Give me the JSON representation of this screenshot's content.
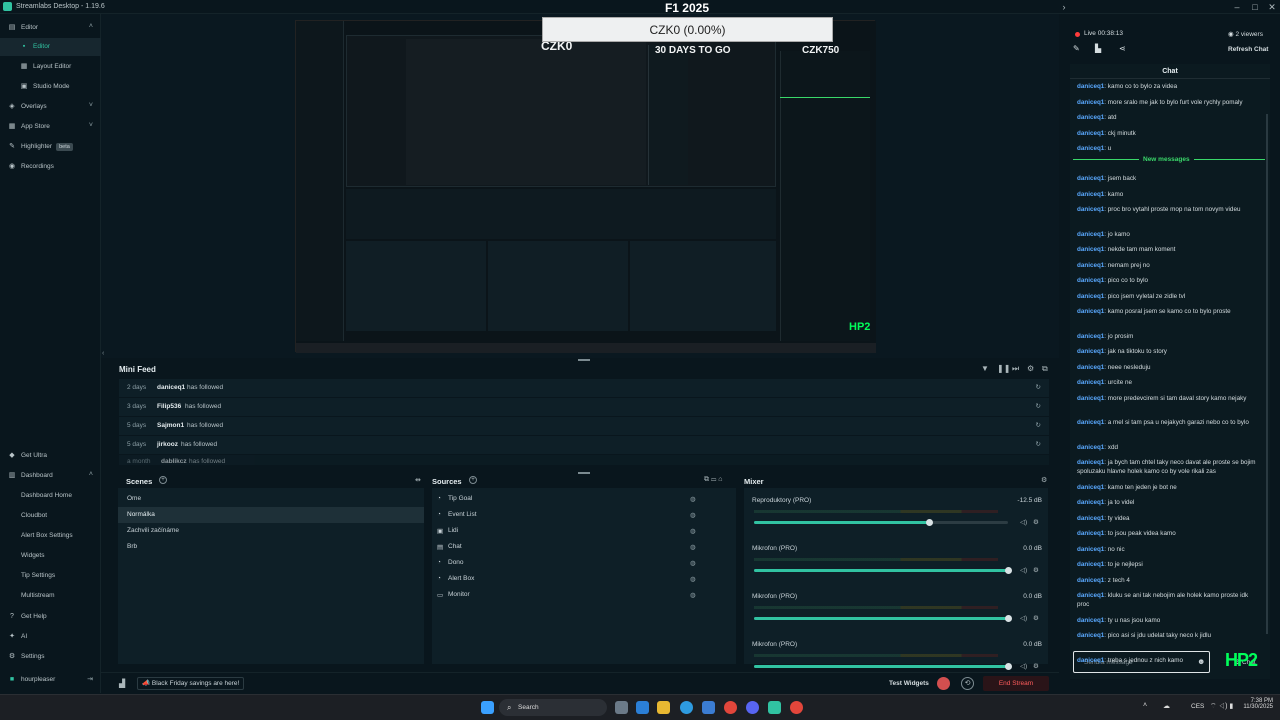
{
  "app": {
    "title": "Streamlabs Desktop - 1.19.6"
  },
  "sidebar": {
    "editor": "Editor",
    "editor_sub": [
      "Editor",
      "Layout Editor",
      "Studio Mode"
    ],
    "overlays": "Overlays",
    "app_store": "App Store",
    "highlighter": "Highlighter",
    "highlighter_badge": "beta",
    "recordings": "Recordings",
    "get_ultra": "Get Ultra",
    "dashboard": "Dashboard",
    "dashboard_sub": [
      "Dashboard Home",
      "Cloudbot",
      "Alert Box Settings",
      "Widgets",
      "Tip Settings",
      "Multistream"
    ],
    "get_help": "Get Help",
    "ai": "AI",
    "settings": "Settings",
    "user": "hourpleaser"
  },
  "preview": {
    "overlay_title": "F1 2025",
    "goal": "CZK0 (0.00%)",
    "goal_current": "CZK0",
    "days_to_go": "30 DAYS TO GO",
    "goal_target": "CZK750"
  },
  "minifeed": {
    "title": "Mini Feed",
    "rows": [
      {
        "time": "2 days",
        "name": "daniceq1",
        "action": "has followed"
      },
      {
        "time": "3 days",
        "name": "Filip536",
        "action": "has followed"
      },
      {
        "time": "5 days",
        "name": "Sajmon1",
        "action": "has followed"
      },
      {
        "time": "5 days",
        "name": "jirkooz",
        "action": "has followed"
      },
      {
        "time": "a month",
        "name": "dablikcz",
        "action": "has followed"
      }
    ]
  },
  "scenes": {
    "title": "Scenes",
    "items": [
      "Ome",
      "Normálka",
      "Zachvili začínáme",
      "Brb"
    ],
    "selected": 1
  },
  "sources": {
    "title": "Sources",
    "items": [
      {
        "label": "Tip Goal",
        "icon": "widget-icon"
      },
      {
        "label": "Event List",
        "icon": "widget-icon"
      },
      {
        "label": "Lidi",
        "icon": "image-icon"
      },
      {
        "label": "Chat",
        "icon": "chat-icon"
      },
      {
        "label": "Dono",
        "icon": "widget-icon"
      },
      {
        "label": "Alert Box",
        "icon": "widget-icon"
      },
      {
        "label": "Monitor",
        "icon": "monitor-icon"
      }
    ]
  },
  "mixer": {
    "title": "Mixer",
    "channels": [
      {
        "name": "Reproduktory (PRO)",
        "db": "-12.5 dB",
        "level": 0.69
      },
      {
        "name": "Mikrofon (PRO)",
        "db": "0.0 dB",
        "level": 1.0
      },
      {
        "name": "Mikrofon (PRO)",
        "db": "0.0 dB",
        "level": 1.0
      },
      {
        "name": "Mikrofon (PRO)",
        "db": "0.0 dB",
        "level": 1.0
      }
    ]
  },
  "footer": {
    "promo": "Black Friday savings are here!",
    "test_widgets": "Test Widgets",
    "end_stream": "End Stream"
  },
  "chat": {
    "live": "Live 00:38:13",
    "viewers": "2 viewers",
    "refresh": "Refresh Chat",
    "title": "Chat",
    "new_messages": "New messages",
    "placeholder": "Send a message",
    "send_label": "Chat",
    "messages_before": [
      {
        "user": "daniceq1",
        "text": "kamo co to bylo za videa"
      },
      {
        "user": "daniceq1",
        "text": "more sralo me jak to bylo furt vole rychly pomaly"
      },
      {
        "user": "daniceq1",
        "text": "atd"
      },
      {
        "user": "daniceq1",
        "text": "ckj minutk"
      },
      {
        "user": "daniceq1",
        "text": "u"
      }
    ],
    "messages_after": [
      {
        "user": "daniceq1",
        "text": "jsem back"
      },
      {
        "user": "daniceq1",
        "text": "kamo"
      },
      {
        "user": "daniceq1",
        "text": "proc bro vytahl proste mop na tom novym videu"
      },
      {
        "user": "daniceq1",
        "text": "jo kamo"
      },
      {
        "user": "daniceq1",
        "text": "nekde tam mam koment"
      },
      {
        "user": "daniceq1",
        "text": "nemam prej no"
      },
      {
        "user": "daniceq1",
        "text": "pico co to bylo"
      },
      {
        "user": "daniceq1",
        "text": "pico jsem vyletal ze zidle tvl"
      },
      {
        "user": "daniceq1",
        "text": "kamo posral jsem se kamo co to bylo proste"
      },
      {
        "user": "daniceq1",
        "text": "jo prosim"
      },
      {
        "user": "daniceq1",
        "text": "jak na tiktoku to story"
      },
      {
        "user": "daniceq1",
        "text": "neee nesleduju"
      },
      {
        "user": "daniceq1",
        "text": "urcite ne"
      },
      {
        "user": "daniceq1",
        "text": "more predevcirem si tam daval story kamo nejaky"
      },
      {
        "user": "daniceq1",
        "text": "a mel si tam psa u nejakych garazi nebo co to bylo"
      },
      {
        "user": "daniceq1",
        "text": "xdd"
      },
      {
        "user": "daniceq1",
        "text": "ja bych tam chtel taky neco davat ale proste se bojim spoluzaku hlavne holek kamo co by vole rikali zas"
      },
      {
        "user": "daniceq1",
        "text": "kamo ten jeden je bot ne"
      },
      {
        "user": "daniceq1",
        "text": "ja to videl"
      },
      {
        "user": "daniceq1",
        "text": "ty videa"
      },
      {
        "user": "daniceq1",
        "text": "to jsou peak videa kamo"
      },
      {
        "user": "daniceq1",
        "text": "no nic"
      },
      {
        "user": "daniceq1",
        "text": "to je nejlepsi"
      },
      {
        "user": "daniceq1",
        "text": "z tech 4"
      },
      {
        "user": "daniceq1",
        "text": "kluku se ani tak nebojim ale holek kamo proste idk proc"
      },
      {
        "user": "daniceq1",
        "text": "ty u nas jsou kamo"
      },
      {
        "user": "daniceq1",
        "text": "pico asi si jdu udelat taky neco k jidlu"
      },
      {
        "user": "daniceq1",
        "text": "treba s jednou z nich kamo"
      }
    ]
  },
  "taskbar": {
    "search": "Search",
    "time": "7:38 PM",
    "date": "11/30/2025",
    "lang": "CES"
  }
}
